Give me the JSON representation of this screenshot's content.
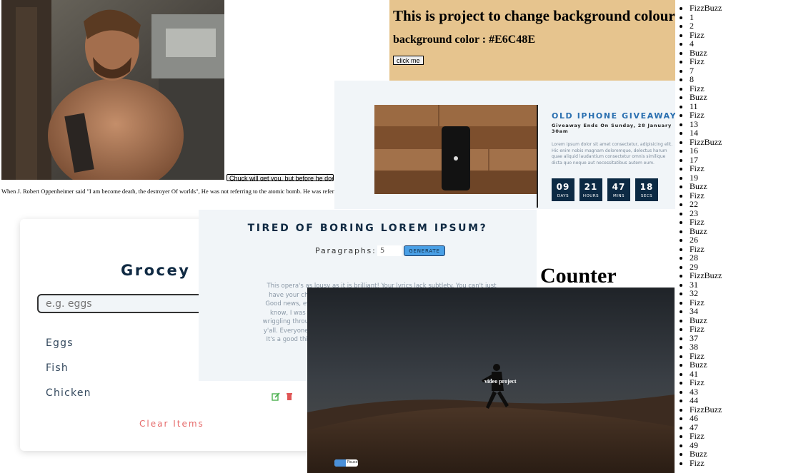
{
  "chuck": {
    "button_label": "Chuck will get you, but before he does he will quote",
    "quote_text": "When J. Robert Oppenheimer said \"I am become death, the destroyer Of worlds\", He was not referring to the atomic bomb. He was referring"
  },
  "background_project": {
    "title": "This is project to change background colour",
    "subtitle": "background color : #E6C48E",
    "button_label": "click me",
    "color": "#E6C48E"
  },
  "giveaway": {
    "title": "OLD IPHONE GIVEAWAY",
    "ends_text": "Giveaway Ends On Sunday, 28 January 30am",
    "body": "Lorem ipsum dolor sit amet consectetur, adipisicing elit. Hic enim nobis magnam doloremque, delectus harum quae aliquid laudantium consectetur omnis similique dicta quo neque aut necessitatibus autem eum.",
    "countdown": [
      {
        "value": "09",
        "label": "DAYS"
      },
      {
        "value": "21",
        "label": "HOURS"
      },
      {
        "value": "47",
        "label": "MINS"
      },
      {
        "value": "18",
        "label": "SECS"
      }
    ]
  },
  "grocery": {
    "title": "Grocey Bud",
    "placeholder": "e.g. eggs",
    "items": [
      "Eggs",
      "Fish",
      "Chicken"
    ],
    "clear_label": "Clear Items"
  },
  "lorem": {
    "title": "TIRED OF BORING LOREM IPSUM?",
    "paragraphs_label": "Paragraphs:",
    "paragraphs_value": "5",
    "generate_label": "GENERATE",
    "text": "This opera's as lousy as it is brilliant! Your lyrics lack subtlety. You can't just have your characters announce how they feel. That makes me feel angry! Good news, everyone! There's a report on TV with some very bad news! You know, I was God once. I saw you with those two ghosts. Do you make me wriggling through the corridor. Why would a robot need to drink? Check it out, y'all. Everyone who was invited is here. Bender, quit destroying the universe! It's a good thing, you jerk! I'm just glad my fat, ugly mama isn't alive to see this day. I don't want to understand his fist."
  },
  "counter": {
    "title": "Counter"
  },
  "video": {
    "title": "video project",
    "switch_label": "Pause"
  },
  "fizzbuzz": {
    "items": [
      "FizzBuzz",
      "1",
      "2",
      "Fizz",
      "4",
      "Buzz",
      "Fizz",
      "7",
      "8",
      "Fizz",
      "Buzz",
      "11",
      "Fizz",
      "13",
      "14",
      "FizzBuzz",
      "16",
      "17",
      "Fizz",
      "19",
      "Buzz",
      "Fizz",
      "22",
      "23",
      "Fizz",
      "Buzz",
      "26",
      "Fizz",
      "28",
      "29",
      "FizzBuzz",
      "31",
      "32",
      "Fizz",
      "34",
      "Buzz",
      "Fizz",
      "37",
      "38",
      "Fizz",
      "Buzz",
      "41",
      "Fizz",
      "43",
      "44",
      "FizzBuzz",
      "46",
      "47",
      "Fizz",
      "49",
      "Buzz",
      "Fizz"
    ]
  }
}
